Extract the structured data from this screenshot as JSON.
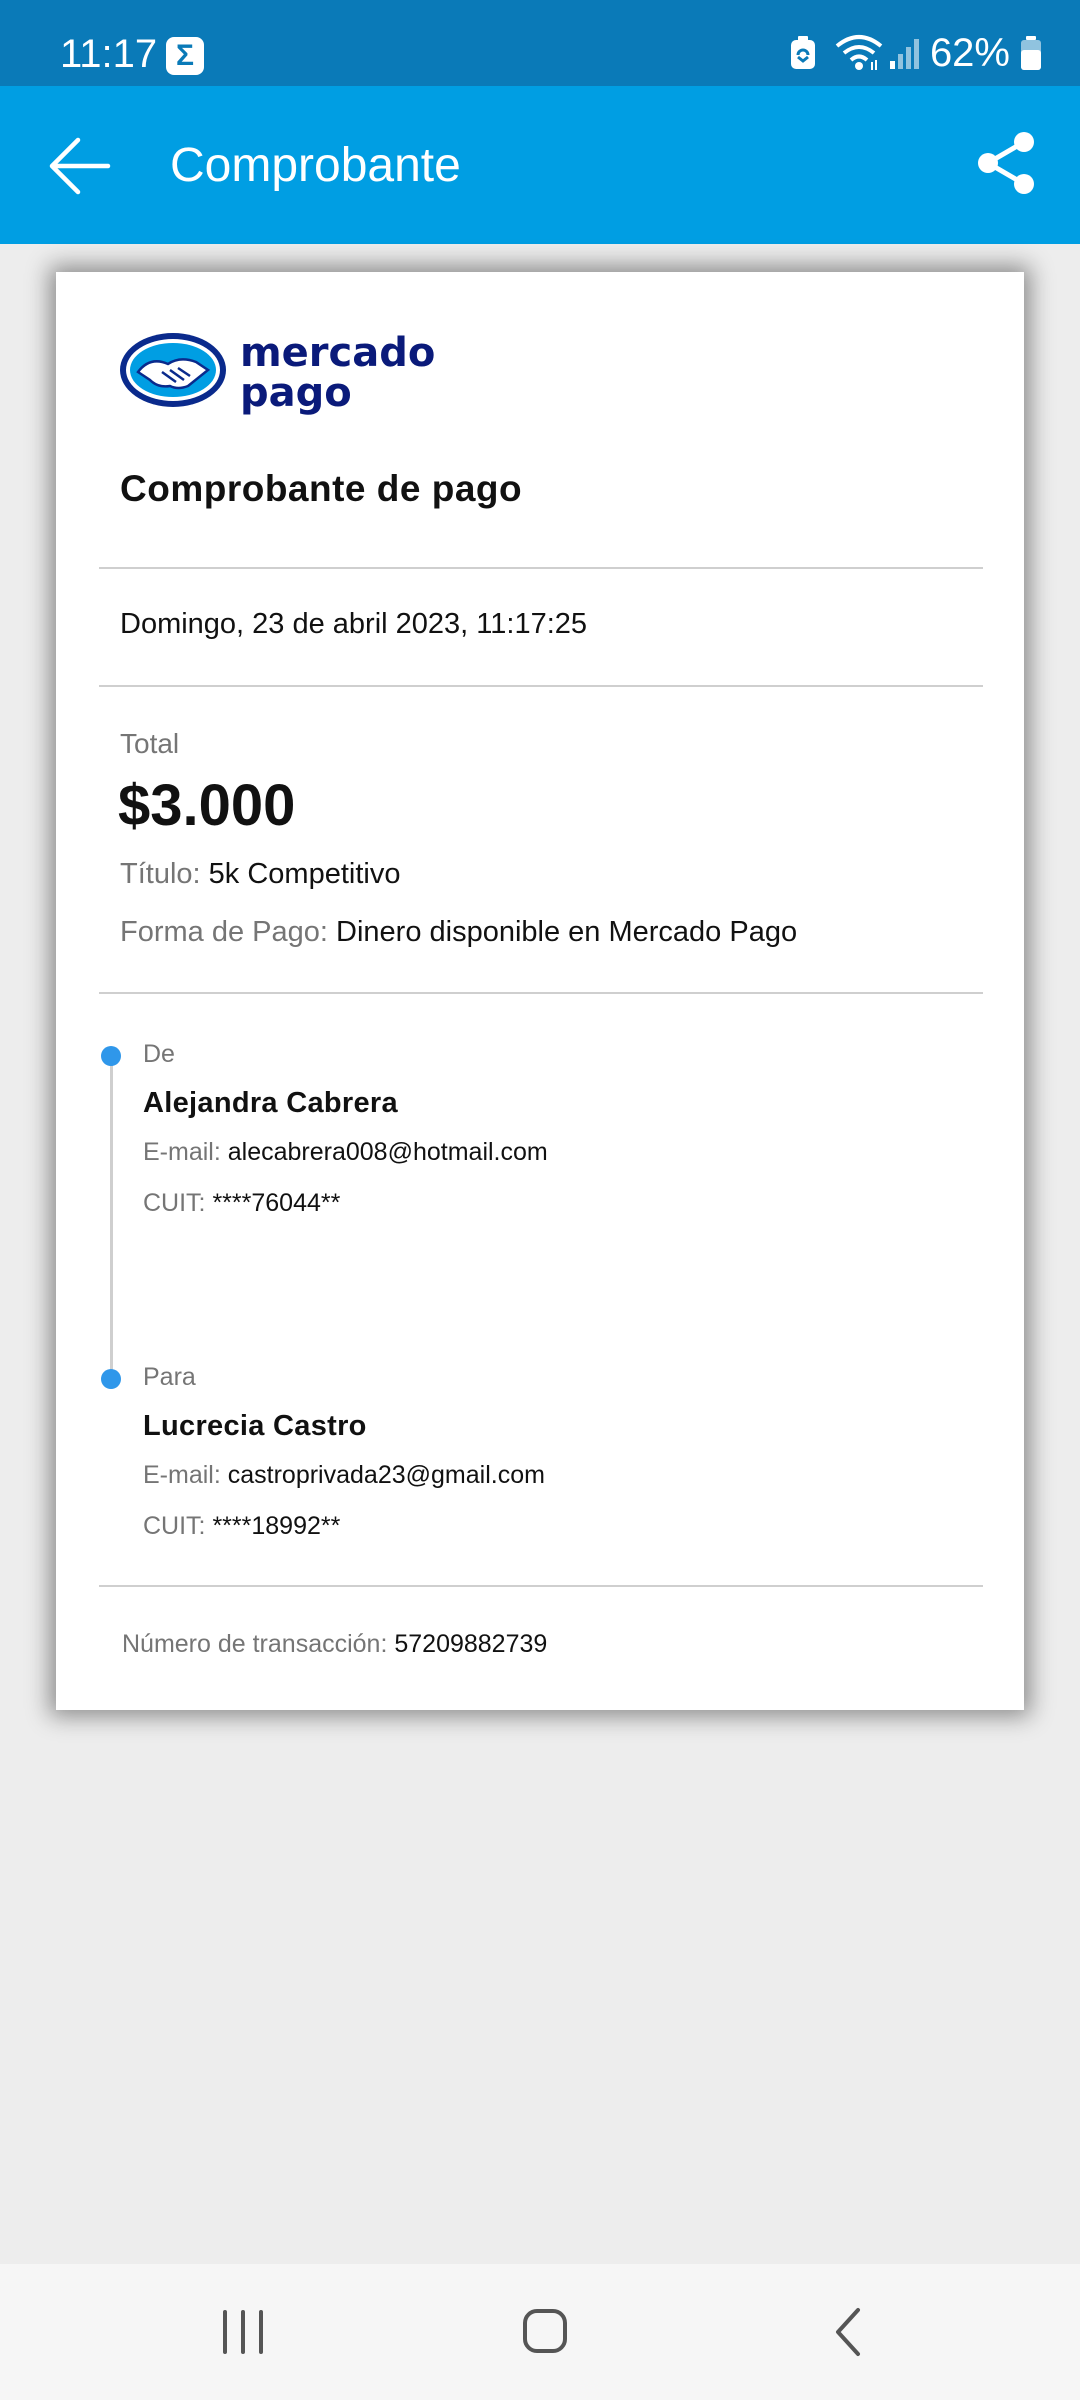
{
  "status_bar": {
    "time": "11:17",
    "notification_icon": "sigma-icon",
    "battery_percent": "62%",
    "icons": [
      "battery-saver-icon",
      "wifi-icon",
      "signal-icon",
      "battery-icon"
    ]
  },
  "app_bar": {
    "title": "Comprobante",
    "back_icon": "arrow-left-icon",
    "share_icon": "share-icon",
    "color": "#009ee3"
  },
  "receipt": {
    "logo_text_line1": "mercado",
    "logo_text_line2": "pago",
    "title": "Comprobante de pago",
    "date": "Domingo, 23 de abril 2023, 11:17:25",
    "total_label": "Total",
    "total_amount": "$3.000",
    "title_label": "Título:",
    "title_value": "5k Competitivo",
    "payment_method_label": "Forma de Pago:",
    "payment_method_value": "Dinero disponible en Mercado Pago",
    "from": {
      "label": "De",
      "name": "Alejandra Cabrera",
      "email_label": "E-mail:",
      "email": "alecabrera008@hotmail.com",
      "cuit_label": "CUIT:",
      "cuit": "****76044**"
    },
    "to": {
      "label": "Para",
      "name": "Lucrecia Castro",
      "email_label": "E-mail:",
      "email": "castroprivada23@gmail.com",
      "cuit_label": "CUIT:",
      "cuit": "****18992**"
    },
    "transaction_label": "Número de transacción:",
    "transaction_number": "57209882739"
  },
  "nav_bar": {
    "recents_icon": "recent-apps-icon",
    "home_icon": "home-icon",
    "back_icon": "nav-back-icon"
  }
}
